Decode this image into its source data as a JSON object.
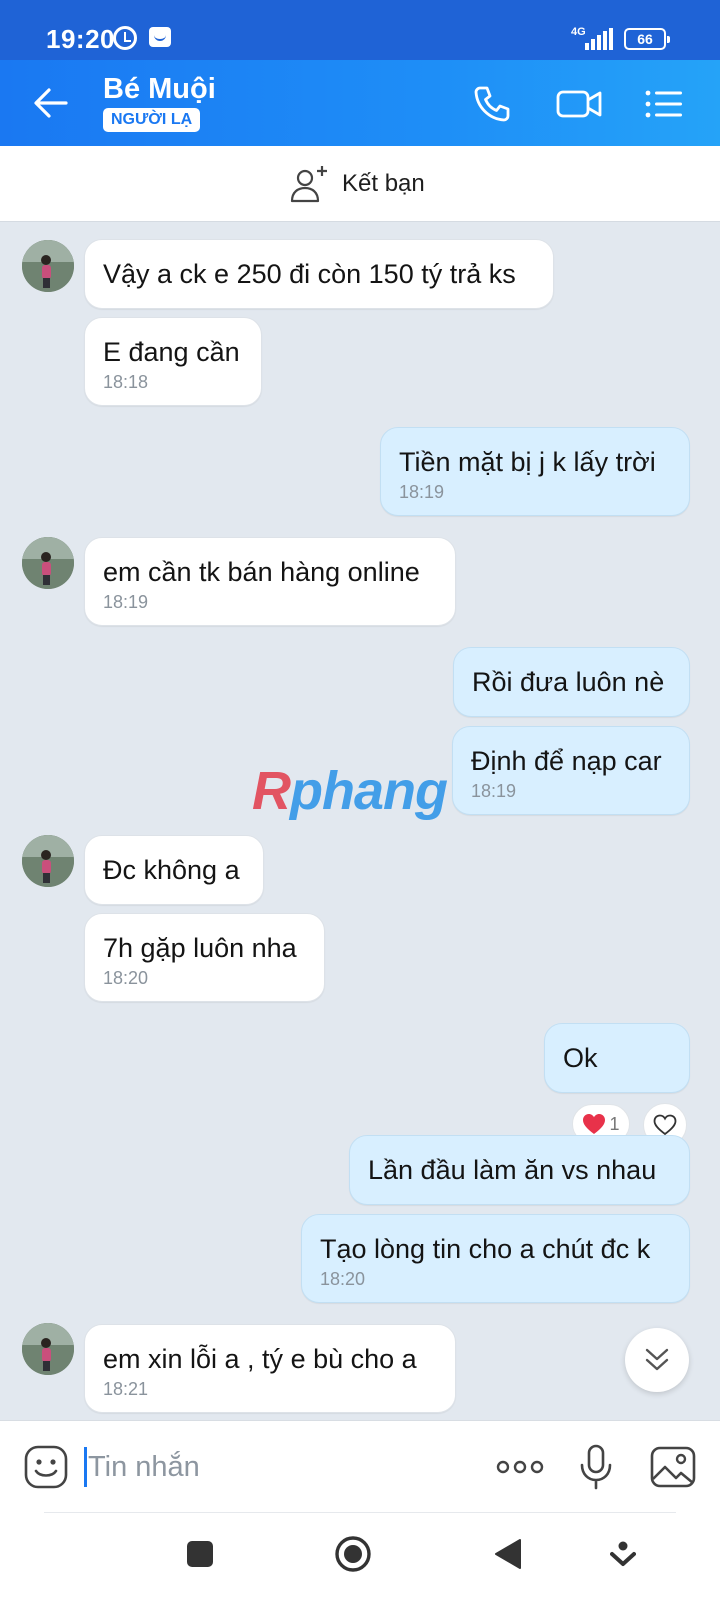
{
  "status_bar": {
    "time": "19:20",
    "network": "4G",
    "battery": "66"
  },
  "header": {
    "contact_name": "Bé Muội",
    "badge": "NGƯỜI LẠ"
  },
  "add_friend": {
    "label": "Kết bạn"
  },
  "messages": [
    {
      "dir": "in",
      "text": "Vậy a ck e 250 đi còn 150 tý trả ks",
      "time": ""
    },
    {
      "dir": "in",
      "text": "E đang cần",
      "time": "18:18"
    },
    {
      "dir": "out",
      "text": "Tiền mặt bị j k lấy trời",
      "time": "18:19"
    },
    {
      "dir": "in",
      "text": "em cần tk bán hàng online",
      "time": "18:19"
    },
    {
      "dir": "out",
      "text": "Rồi đưa luôn nè",
      "time": ""
    },
    {
      "dir": "out",
      "text": "Định để nạp car",
      "time": "18:19"
    },
    {
      "dir": "in",
      "text": "Đc không a",
      "time": ""
    },
    {
      "dir": "in",
      "text": "7h gặp luôn nha",
      "time": "18:20"
    },
    {
      "dir": "out",
      "text": "Ok",
      "time": ""
    },
    {
      "dir": "out",
      "text": "Lần đầu làm ăn vs nhau",
      "time": ""
    },
    {
      "dir": "out",
      "text": "Tạo lòng tin cho a chút đc k",
      "time": "18:20"
    },
    {
      "dir": "in",
      "text": "em xin lỗi a , tý e bù cho a",
      "time": "18:21"
    }
  ],
  "reaction": {
    "emoji": "heart-icon",
    "count": "1"
  },
  "watermark": {
    "first": "R",
    "rest": "phang"
  },
  "composer": {
    "placeholder": "Tin nhắn"
  },
  "colors": {
    "header": "#1a78f2",
    "bubble_out": "#d8efff",
    "bubble_in": "#ffffff",
    "background": "#e2e8ef"
  }
}
